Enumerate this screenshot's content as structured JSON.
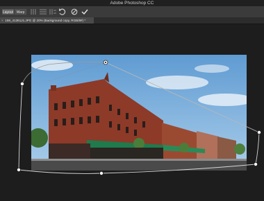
{
  "app": {
    "title": "Adobe Photoshop CC"
  },
  "options_bar": {
    "layout_label": "Layout",
    "warp_label": "Warp",
    "tools": [
      {
        "name": "vertical-straighten-icon"
      },
      {
        "name": "horizontal-straighten-icon"
      },
      {
        "name": "straighten-both-icon"
      },
      {
        "name": "undo-icon"
      },
      {
        "name": "cancel-icon"
      },
      {
        "name": "commit-icon"
      }
    ]
  },
  "document": {
    "tab_label": "159_41361J1.JPG @ 20% (Background copy, RGB/8#) *"
  },
  "colors": {
    "sky": "#7fb1dc",
    "brick": "#8d3a28",
    "awning": "#1f7a4c",
    "pin_line": "#9a9a9a"
  }
}
